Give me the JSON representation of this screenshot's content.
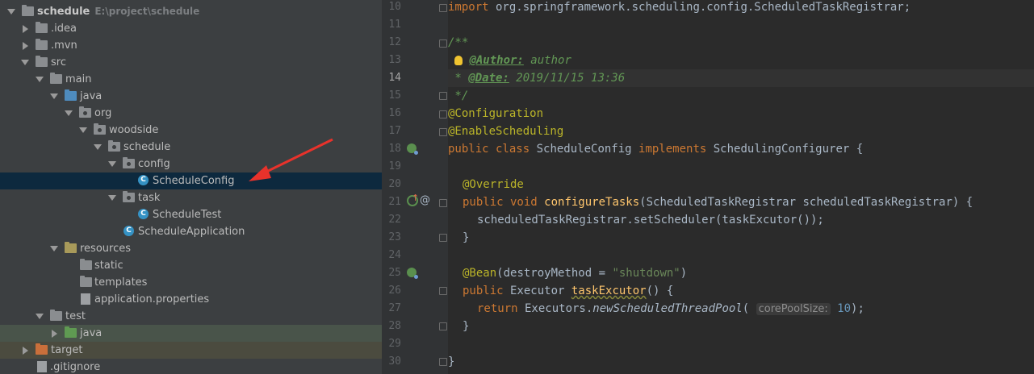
{
  "project_tree": {
    "root": {
      "name": "schedule",
      "path": "E:\\project\\schedule"
    },
    "items": [
      {
        "label": ".idea"
      },
      {
        "label": ".mvn"
      },
      {
        "label": "src"
      },
      {
        "label": "main"
      },
      {
        "label": "java"
      },
      {
        "label": "org"
      },
      {
        "label": "woodside"
      },
      {
        "label": "schedule"
      },
      {
        "label": "config"
      },
      {
        "label": "ScheduleConfig",
        "selected": true
      },
      {
        "label": "task"
      },
      {
        "label": "ScheduleTest"
      },
      {
        "label": "ScheduleApplication"
      },
      {
        "label": "resources"
      },
      {
        "label": "static"
      },
      {
        "label": "templates"
      },
      {
        "label": "application.properties"
      },
      {
        "label": "test"
      },
      {
        "label": "java"
      },
      {
        "label": "target"
      },
      {
        "label": ".gitignore"
      }
    ]
  },
  "editor": {
    "line_numbers": [
      "10",
      "11",
      "12",
      "13",
      "14",
      "15",
      "16",
      "17",
      "18",
      "19",
      "20",
      "21",
      "22",
      "23",
      "24",
      "25",
      "26",
      "27",
      "28",
      "29",
      "30"
    ],
    "current_line": "14",
    "code": {
      "l10_import": "import",
      "l10_rest": " org.springframework.scheduling.config.ScheduledTaskRegistrar;",
      "l12": "/**",
      "l13_tag": "@Author:",
      "l13_text": " author",
      "l14_star": " * ",
      "l14_tag": "@Date:",
      "l14_text": " 2019/11/15 13:36",
      "l15": " */",
      "l16": "@Configuration",
      "l17": "@EnableScheduling",
      "l18_kw": "public class",
      "l18_name": " ScheduleConfig ",
      "l18_impl": "implements",
      "l18_rest": " SchedulingConfigurer {",
      "l20": "@Override",
      "l21_kw": "public void",
      "l21_fn": "configureTasks",
      "l21_rest": "(ScheduledTaskRegistrar scheduledTaskRegistrar) {",
      "l22": "scheduledTaskRegistrar.setScheduler(taskExcutor());",
      "l23": "}",
      "l25_ann": "@Bean",
      "l25_paren": "(destroyMethod = ",
      "l25_str": "\"shutdown\"",
      "l25_close": ")",
      "l26_kw": "public",
      "l26_type": " Executor ",
      "l26_fn": "taskExcutor",
      "l26_rest": "() {",
      "l27_kw": "return",
      "l27_cls": " Executors.",
      "l27_fn": "newScheduledThreadPool",
      "l27_open": "( ",
      "l27_hint": "corePoolSize:",
      "l27_num": "10",
      "l27_close": ");",
      "l28": "}",
      "l30": "}"
    }
  }
}
